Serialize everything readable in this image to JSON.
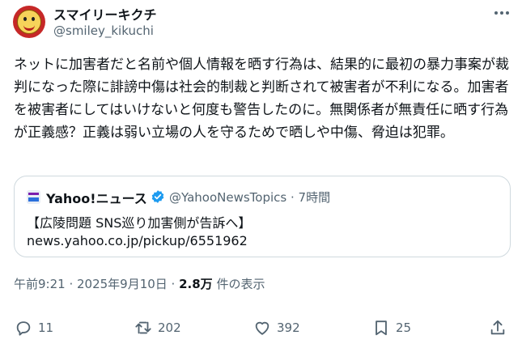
{
  "author": {
    "display_name": "スマイリーキクチ",
    "handle": "@smiley_kikuchi"
  },
  "tweet_text": "ネットに加害者だと名前や個人情報を晒す行為は、結果的に最初の暴力事案が裁判になった際に誹謗中傷は社会的制裁と判断されて被害者が不利になる。加害者を被害者にしてはいけないと何度も警告したのに。無関係者が無責任に晒す行為が正義感？正義は弱い立場の人を守るためで晒しや中傷、脅迫は犯罪。",
  "quote": {
    "name": "Yahoo!ニュース",
    "meta": "@YahooNewsTopics · 7時間",
    "headline": "【広陵問題 SNS巡り加害側が告訴へ】",
    "link": "news.yahoo.co.jp/pickup/6551962"
  },
  "timestamp": {
    "time": "午前9:21 · 2025年9月10日 · ",
    "views": "2.8万",
    "views_suffix": " 件の表示"
  },
  "actions": {
    "reply_count": "11",
    "retweet_count": "202",
    "like_count": "392",
    "bookmark_count": "25"
  },
  "icons": [
    "more-icon",
    "verified-badge-icon",
    "reply-icon",
    "retweet-icon",
    "like-icon",
    "bookmark-icon",
    "share-icon"
  ],
  "colors": {
    "verified": "#1d9bf0",
    "secondary_text": "#536471",
    "border": "#cfd9de"
  }
}
